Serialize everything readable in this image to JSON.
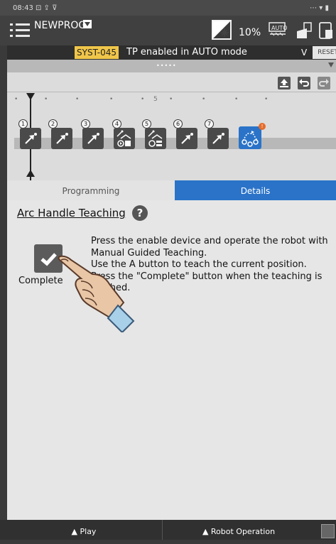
{
  "status_bar": {
    "time": "08:43 ⊡ ⇪ ⊽",
    "right": "⋯ ▾ ▮"
  },
  "header": {
    "program_name": "NEWPROG",
    "speed_override": "10%",
    "mode_icon": "auto-mode-icon"
  },
  "alarm": {
    "code": "SYST-045",
    "message": "TP enabled in AUTO mode",
    "expand_label": "V",
    "reset_label": "RESET"
  },
  "handle": {
    "dots": "•••••"
  },
  "timeline": {
    "ruler_mark": "5",
    "commands": [
      {
        "number": "1",
        "icon": "linear-motion-icon"
      },
      {
        "number": "2",
        "icon": "linear-motion-icon"
      },
      {
        "number": "3",
        "icon": "linear-motion-icon"
      },
      {
        "number": "4",
        "icon": "arc-start-icon"
      },
      {
        "number": "5",
        "icon": "arc-end-icon"
      },
      {
        "number": "6",
        "icon": "linear-motion-icon"
      },
      {
        "number": "7",
        "icon": "linear-motion-icon"
      },
      {
        "number": "",
        "icon": "arc-handle-teach-icon",
        "badge": "!"
      }
    ]
  },
  "tabs": {
    "programming": "Programming",
    "details": "Details"
  },
  "content": {
    "title": "Arc Handle Teaching",
    "help": "?",
    "complete_label": "Complete",
    "instructions": [
      "Press the enable device and operate the robot with",
      "Manual Guided Teaching.",
      "Use the A button to teach the current position.",
      "Press the \"Complete\" button when the teaching is",
      "finished."
    ]
  },
  "bottom": {
    "play": "▲ Play",
    "robot_operation": "▲ Robot Operation"
  },
  "colors": {
    "accent": "#2a73c8",
    "alarm": "#f0c64a",
    "badge": "#e56c2a"
  }
}
